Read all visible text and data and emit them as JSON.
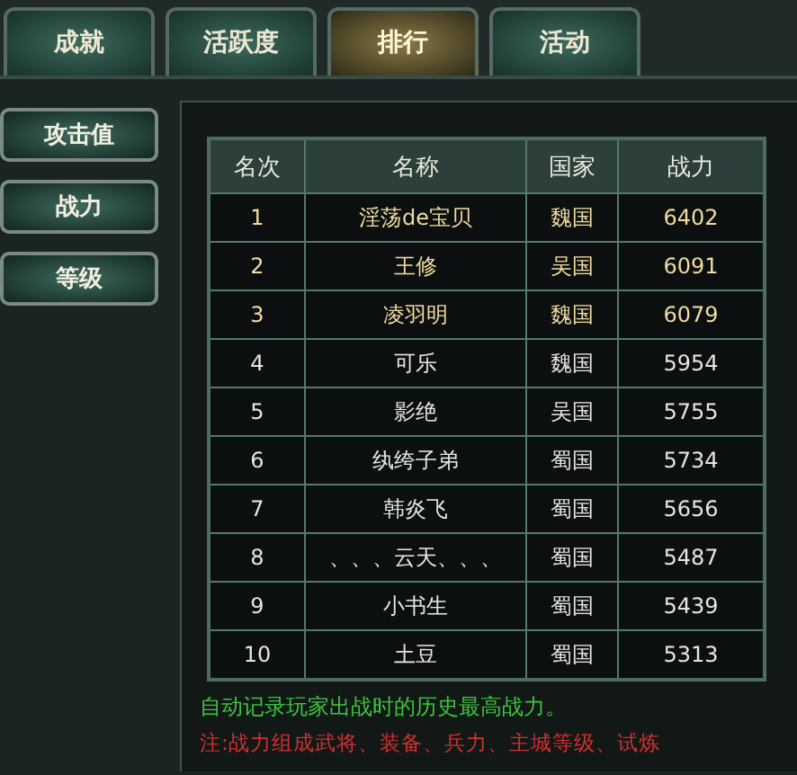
{
  "tabs": [
    {
      "label": "成就",
      "selected": false
    },
    {
      "label": "活跃度",
      "selected": false
    },
    {
      "label": "排行",
      "selected": true
    },
    {
      "label": "活动",
      "selected": false
    }
  ],
  "sidebar": {
    "items": [
      "攻击值",
      "战力",
      "等级"
    ]
  },
  "table": {
    "columns": [
      "名次",
      "名称",
      "国家",
      "战力"
    ],
    "rows": [
      {
        "cells": [
          "1",
          "淫荡de宝贝",
          "魏国",
          "6402"
        ],
        "highlighted": true
      },
      {
        "cells": [
          "2",
          "王修",
          "吴国",
          "6091"
        ],
        "highlighted": true
      },
      {
        "cells": [
          "3",
          "凌羽明",
          "魏国",
          "6079"
        ],
        "highlighted": true
      },
      {
        "cells": [
          "4",
          "可乐",
          "魏国",
          "5954"
        ],
        "highlighted": false
      },
      {
        "cells": [
          "5",
          "影绝",
          "吴国",
          "5755"
        ],
        "highlighted": false
      },
      {
        "cells": [
          "6",
          "纨绔子弟",
          "蜀国",
          "5734"
        ],
        "highlighted": false
      },
      {
        "cells": [
          "7",
          "韩炎飞",
          "蜀国",
          "5656"
        ],
        "highlighted": false
      },
      {
        "cells": [
          "8",
          "、、、云天、、、",
          "蜀国",
          "5487"
        ],
        "highlighted": false
      },
      {
        "cells": [
          "9",
          "小书生",
          "蜀国",
          "5439"
        ],
        "highlighted": false
      },
      {
        "cells": [
          "10",
          "土豆",
          "蜀国",
          "5313"
        ],
        "highlighted": false
      }
    ]
  },
  "notes": [
    {
      "text": "自动记录玩家出战时的历史最高战力。",
      "kind": "info"
    },
    {
      "text": "注:战力组成武将、装备、兵力、主城等级、试炼",
      "kind": "warning"
    }
  ]
}
